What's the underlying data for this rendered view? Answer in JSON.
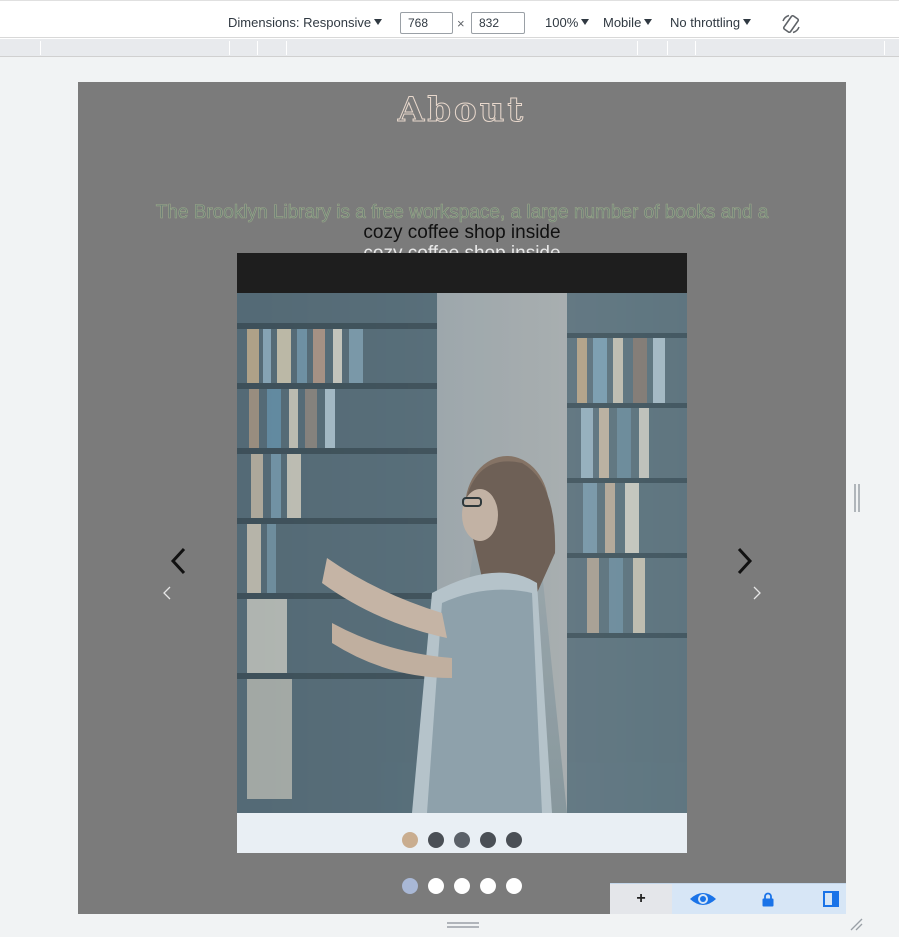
{
  "toolbar": {
    "dimensions_label": "Dimensions: Responsive",
    "width_value": "768",
    "times": "×",
    "height_value": "832",
    "zoom_label": "100%",
    "device_mode_label": "Mobile",
    "throttling_label": "No throttling",
    "rotate_icon": "rotate-icon"
  },
  "page": {
    "title": "About",
    "description_line_1": "The Brooklyn Library is a free workspace, a large number of books and a",
    "description_line_2": "cozy coffee shop inside",
    "description_line_3": "cozy coffee shop inside",
    "slider": {
      "prev_icon": "chevron-left-icon",
      "next_icon": "chevron-right-icon",
      "inner_dot_colors": [
        "#c9ad8f",
        "#4a4f55",
        "#5b6168",
        "#4a4f55",
        "#4a4f55"
      ],
      "outer_dot_colors": [
        "#a9b8d6",
        "#ffffff",
        "#ffffff",
        "#ffffff",
        "#ffffff"
      ],
      "active_index": 0,
      "slide_count": 5
    }
  },
  "dock": {
    "add_label": "+",
    "icons": [
      "eye-icon",
      "lock-icon",
      "dock-side-icon"
    ],
    "accent": "#1a73e8"
  }
}
